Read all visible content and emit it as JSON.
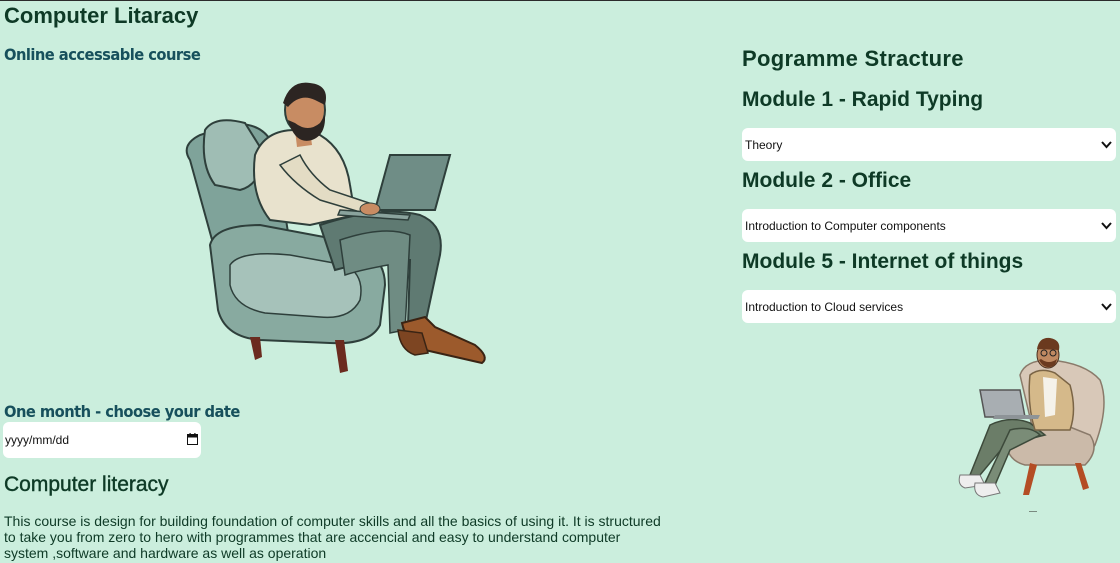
{
  "header": {
    "title": "Computer Litaracy"
  },
  "left": {
    "subtitle": "Online accessable course",
    "hero_image_icon": "man-on-armchair-with-laptop",
    "date_label": "One month - choose your date",
    "date_input": {
      "placeholder": "yyyy/mm/dd",
      "value": "yyyy/mm/dd"
    },
    "section_heading": "Computer literacy",
    "description": "This course is design for building foundation of computer skills and all the basics of using it. It is structured to take you from zero to hero with programmes that are accencial and easy to understand computer system ,software and hardware as well as operation"
  },
  "right": {
    "title": "Pogramme Stracture",
    "modules": [
      {
        "heading": "Module 1 - Rapid Typing",
        "selected": "Theory"
      },
      {
        "heading": "Module 2 - Office",
        "selected": "Introduction to Computer components"
      },
      {
        "heading": "Module 5 - Internet of things",
        "selected": "Introduction to Cloud services"
      }
    ],
    "side_image_icon": "man-with-glasses-on-armchair-with-laptop"
  },
  "colors": {
    "background": "#cbeedd",
    "heading": "#0e3a26",
    "subheading": "#17505c",
    "field": "#ffffff"
  }
}
